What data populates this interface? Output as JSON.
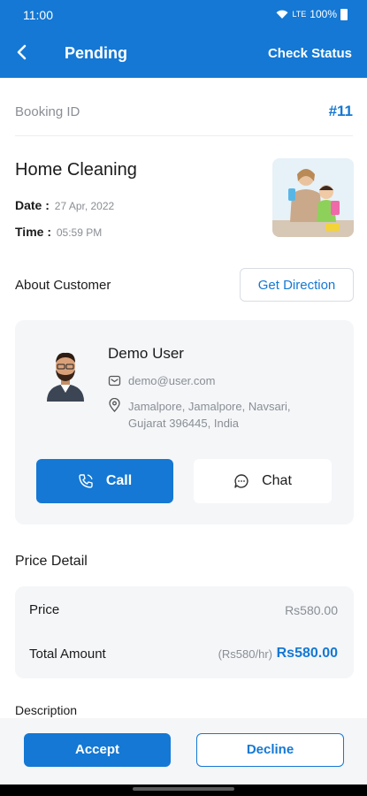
{
  "status_bar": {
    "time": "11:00",
    "network": "LTE",
    "battery": "100%"
  },
  "app_bar": {
    "title": "Pending",
    "action_label": "Check Status"
  },
  "booking": {
    "id_label": "Booking ID",
    "id_value": "#11"
  },
  "service": {
    "name": "Home Cleaning",
    "date_label": "Date :",
    "date_value": "27 Apr, 2022",
    "time_label": "Time :",
    "time_value": "05:59 PM"
  },
  "customer_section": {
    "title": "About Customer",
    "direction_button": "Get Direction",
    "name": "Demo User",
    "email": "demo@user.com",
    "address": "Jamalpore, Jamalpore, Navsari, Gujarat 396445, India",
    "call_label": "Call",
    "chat_label": "Chat"
  },
  "price_detail": {
    "title": "Price Detail",
    "price_label": "Price",
    "price_value": "Rs580.00",
    "total_label": "Total Amount",
    "rate_text": "(Rs580/hr)",
    "total_value": "Rs580.00"
  },
  "description": {
    "title": "Description"
  },
  "actions": {
    "accept_label": "Accept",
    "decline_label": "Decline"
  },
  "colors": {
    "primary": "#1478d4",
    "card_bg": "#f4f6f8",
    "muted_text": "#8a8e95"
  },
  "icons": [
    "back-arrow-icon",
    "wifi-icon",
    "battery-icon",
    "mail-icon",
    "location-pin-icon",
    "phone-icon",
    "chat-bubble-icon"
  ]
}
